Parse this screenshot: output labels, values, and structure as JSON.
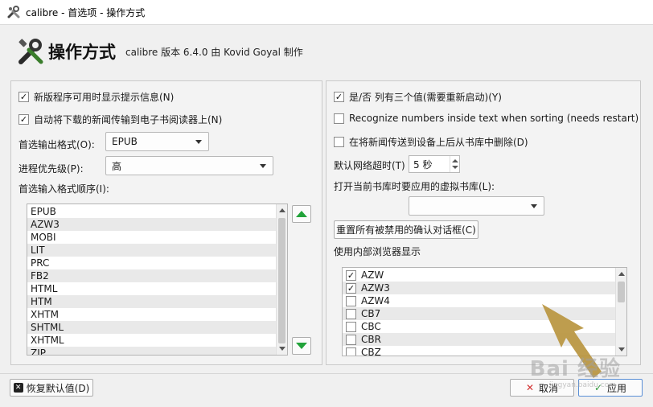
{
  "window": {
    "title": "calibre - 首选项 - 操作方式"
  },
  "header": {
    "title": "操作方式",
    "subtitle": "calibre 版本 6.4.0 由 Kovid Goyal 制作"
  },
  "left": {
    "check1": "新版程序可用时显示提示信息(N)",
    "check2": "自动将下载的新闻传输到电子书阅读器上(N)",
    "output_format_label": "首选输出格式(O):",
    "output_format_value": "EPUB",
    "priority_label": "进程优先级(P):",
    "priority_value": "高",
    "input_order_label": "首选输入格式顺序(I):",
    "formats": [
      "EPUB",
      "AZW3",
      "MOBI",
      "LIT",
      "PRC",
      "FB2",
      "HTML",
      "HTM",
      "XHTM",
      "SHTML",
      "XHTML",
      "ZIP"
    ]
  },
  "right": {
    "check_yesno": "是/否 列有三个值(需要重新启动)(Y)",
    "check_numbers": "Recognize numbers inside text when sorting (needs restart)",
    "check_delete_news": "在将新闻传送到设备上后从书库中删除(D)",
    "timeout_label": "默认网络超时(T)",
    "timeout_value": "5 秒",
    "vlib_label": "打开当前书库时要应用的虚拟书库(L):",
    "vlib_value": "",
    "reset_button": "重置所有被禁用的确认对话框(C)",
    "internal_viewer_label": "使用内部浏览器显示",
    "viewer_formats": [
      {
        "name": "AZW",
        "checked": true
      },
      {
        "name": "AZW3",
        "checked": true
      },
      {
        "name": "AZW4",
        "checked": false
      },
      {
        "name": "CB7",
        "checked": false
      },
      {
        "name": "CBC",
        "checked": false
      },
      {
        "name": "CBR",
        "checked": false
      },
      {
        "name": "CBZ",
        "checked": false
      }
    ]
  },
  "footer": {
    "restore_defaults": "恢复默认值(D)",
    "cancel": "取消",
    "apply": "应用"
  },
  "watermark": {
    "text": "Bai 经验",
    "sub": "jingyan.baidu.com"
  },
  "colors": {
    "accent_green": "#22a33a",
    "cancel_red": "#d23030",
    "apply_green": "#2f9a3a"
  }
}
